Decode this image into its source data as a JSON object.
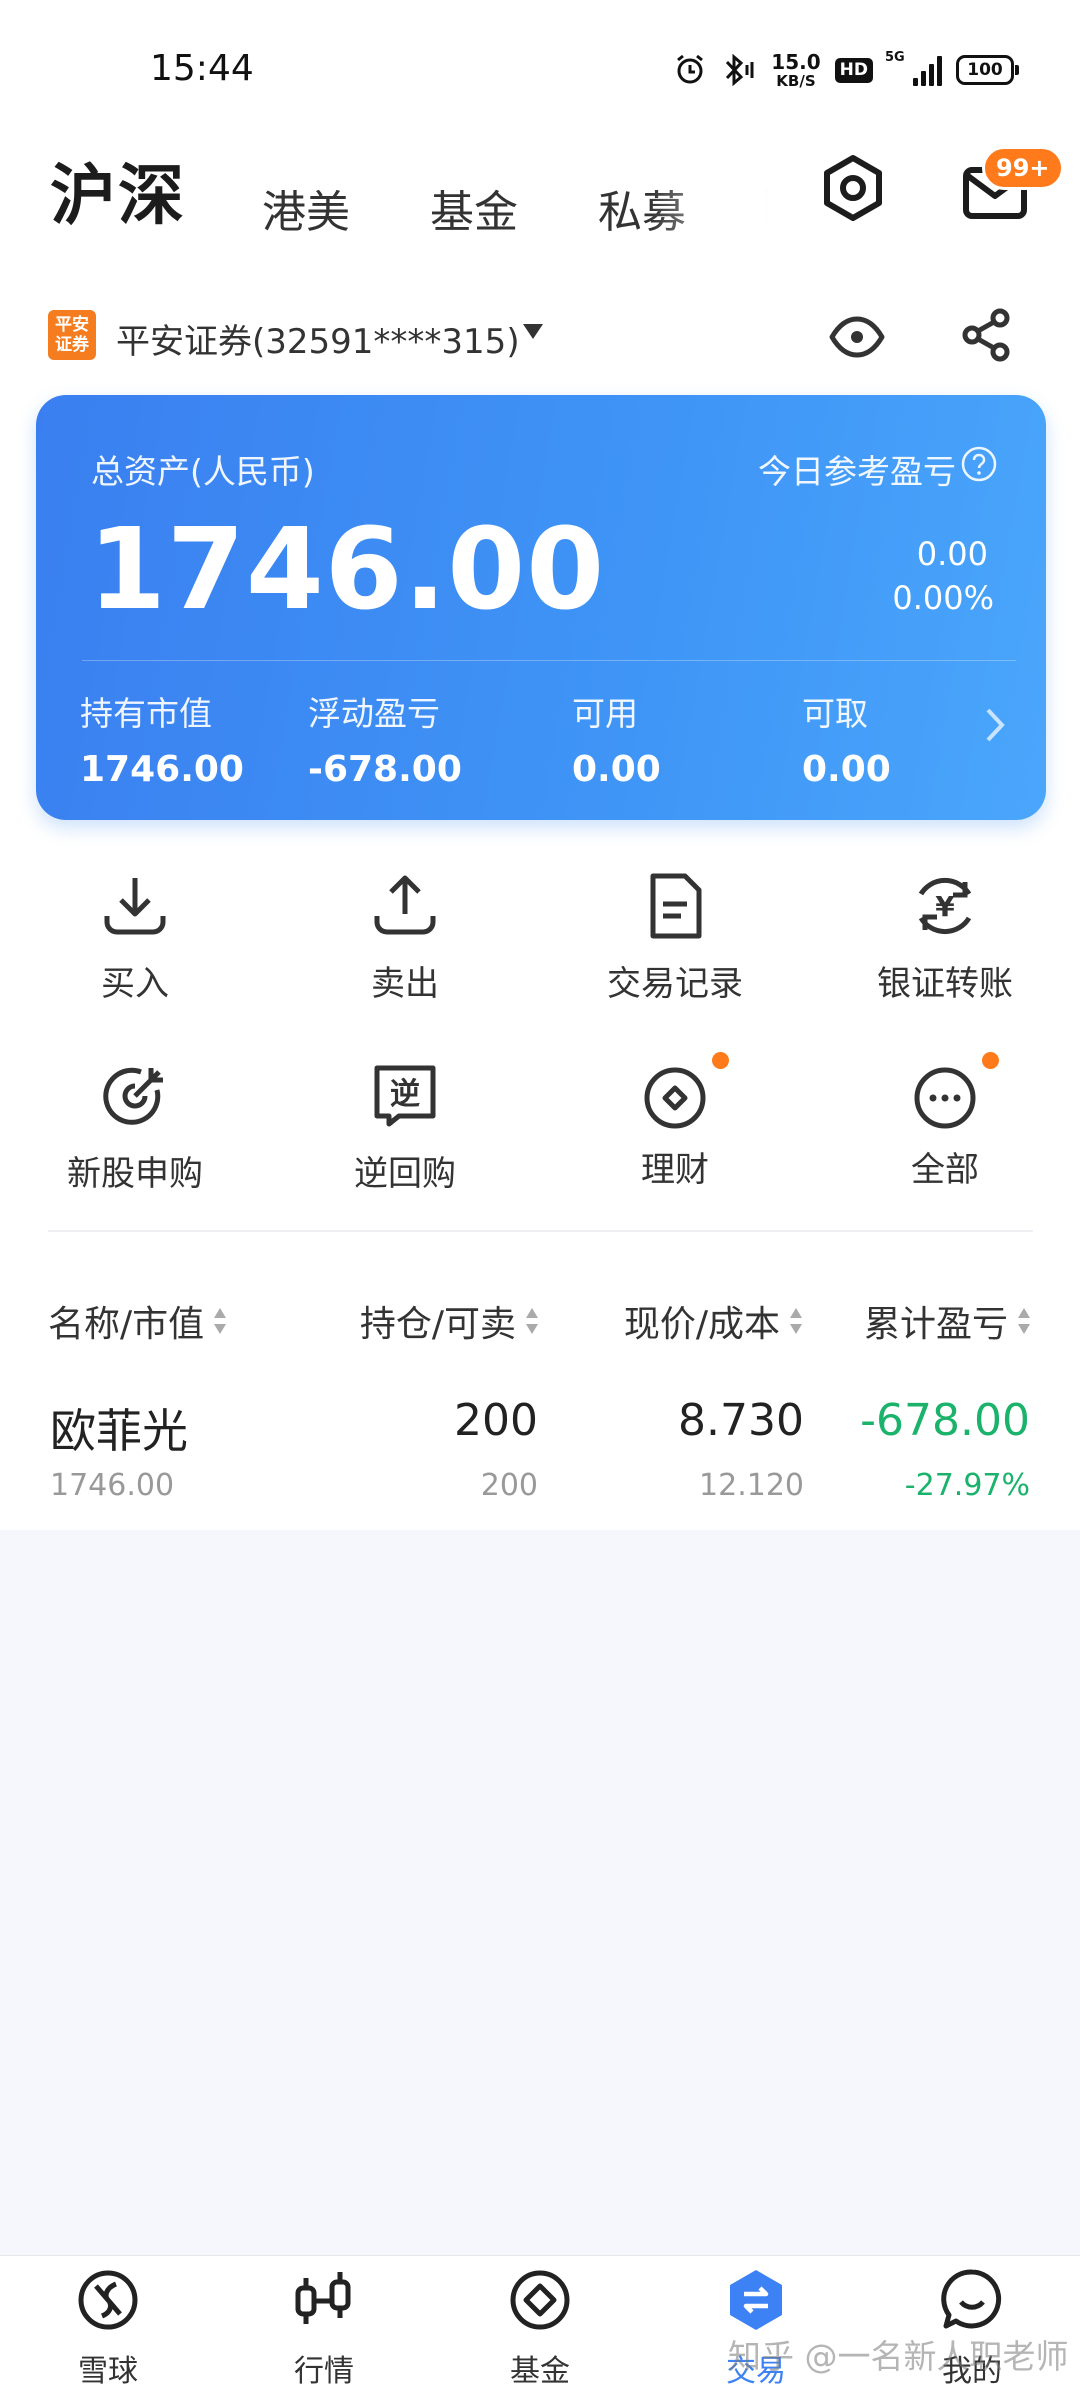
{
  "status_bar": {
    "time": "15:44",
    "net_speed_value": "15.0",
    "net_speed_unit": "KB/S",
    "hd": "HD",
    "network": "5G",
    "battery": "100"
  },
  "header": {
    "tabs": [
      "沪深",
      "港美",
      "基金",
      "私募"
    ],
    "mail_badge": "99+"
  },
  "account": {
    "broker_logo_text": "平安证券",
    "name": "平安证券(32591****315)"
  },
  "asset_card": {
    "total_label": "总资产(人民币)",
    "total_value": "1746.00",
    "today_label": "今日参考盈亏",
    "today_value": "0.00",
    "today_pct": "0.00%",
    "stats": [
      {
        "label": "持有市值",
        "value": "1746.00"
      },
      {
        "label": "浮动盈亏",
        "value": "-678.00"
      },
      {
        "label": "可用",
        "value": "0.00"
      },
      {
        "label": "可取",
        "value": "0.00"
      }
    ]
  },
  "actions": [
    {
      "label": "买入",
      "icon": "download-tray-icon"
    },
    {
      "label": "卖出",
      "icon": "upload-tray-icon"
    },
    {
      "label": "交易记录",
      "icon": "document-icon"
    },
    {
      "label": "银证转账",
      "icon": "yuan-exchange-icon"
    },
    {
      "label": "新股申购",
      "icon": "target-icon"
    },
    {
      "label": "逆回购",
      "icon": "reverse-repo-icon",
      "icon_glyph": "逆"
    },
    {
      "label": "理财",
      "icon": "coin-icon"
    },
    {
      "label": "全部",
      "icon": "more-icon"
    }
  ],
  "positions": {
    "headers": [
      "名称/市值",
      "持仓/可卖",
      "现价/成本",
      "累计盈亏"
    ],
    "rows": [
      {
        "name": "欧菲光",
        "market_value": "1746.00",
        "holding": "200",
        "available": "200",
        "price": "8.730",
        "cost": "12.120",
        "pnl": "-678.00",
        "pnl_pct": "-27.97%"
      }
    ]
  },
  "bottom_nav": [
    "雪球",
    "行情",
    "基金",
    "交易",
    "我的"
  ],
  "watermark": "知乎 @一名新人职老师",
  "colors": {
    "accent": "#3d82f5",
    "card_start": "#3a7ff0",
    "card_end": "#4aa6fb",
    "gain_green": "#1bb36b",
    "badge_orange": "#ff7a1a"
  }
}
